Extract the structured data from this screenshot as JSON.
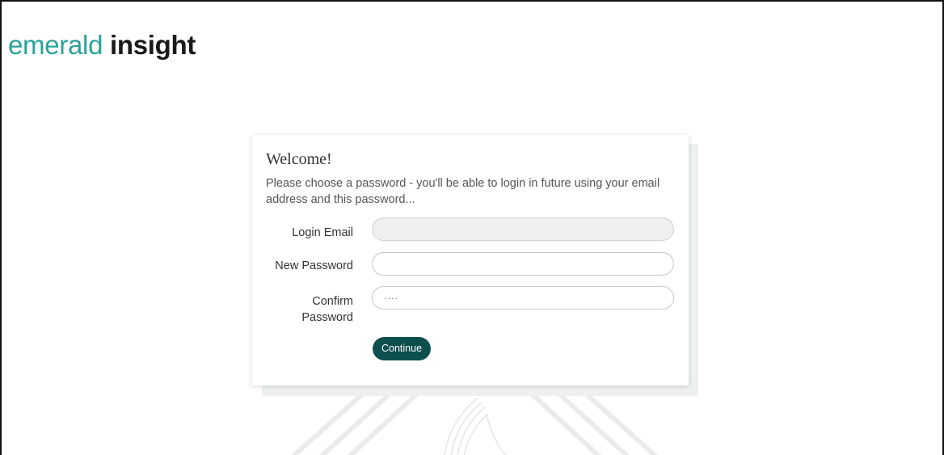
{
  "logo": {
    "light": "emerald",
    "bold": "insight"
  },
  "card": {
    "title": "Welcome!",
    "description": "Please choose a password - you'll be able to login in future using your email address and this password...",
    "fields": [
      {
        "label": "Login Email",
        "value": "",
        "placeholder": ""
      },
      {
        "label": "New Password",
        "value": "",
        "placeholder": ""
      },
      {
        "label": "Confirm Password",
        "value": "····",
        "placeholder": ""
      }
    ],
    "continue_label": "Continue"
  },
  "colors": {
    "brand_teal": "#2aa39a",
    "button_dark_teal": "#0d4f4f",
    "disabled_input_bg": "#efefef"
  }
}
